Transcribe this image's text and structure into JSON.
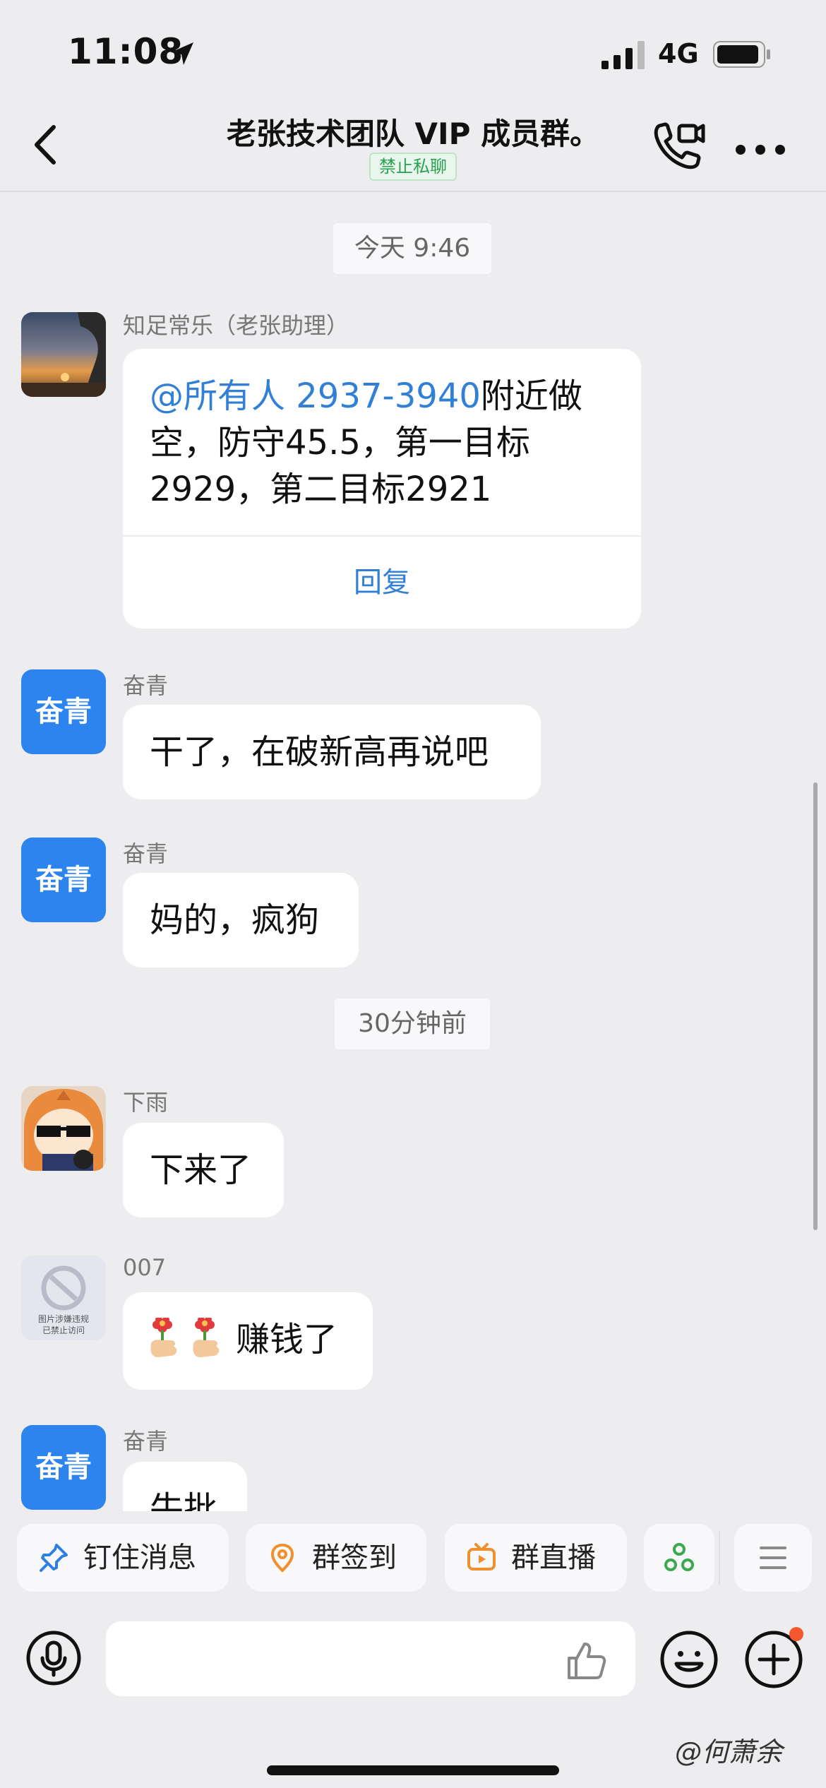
{
  "status_bar": {
    "time": "11:08",
    "network": "4G"
  },
  "header": {
    "title": "老张技术团队 VIP 成员群。",
    "badge": "禁止私聊"
  },
  "timestamps": [
    "今天 9:46",
    "30分钟前"
  ],
  "messages": [
    {
      "sender": "知足常乐（老张助理）",
      "mention": "@所有人 ",
      "text_line1_rest": "2937-3940附近做",
      "text_line1": "2937-3940",
      "text_line2": "空，防守45.5，第一目标",
      "text_line3": "2929，第二目标2921",
      "reply_label": "回复",
      "avatar": "sunset-photo"
    },
    {
      "sender": "奋青",
      "avatar_text": "奋青",
      "text": "干了，在破新高再说吧"
    },
    {
      "sender": "奋青",
      "avatar_text": "奋青",
      "text": "妈的，疯狗"
    },
    {
      "sender": "下雨",
      "avatar": "anime-sunglasses",
      "text": "下来了"
    },
    {
      "sender": "007",
      "avatar_blocked_line1": "图片涉嫌违规",
      "avatar_blocked_line2": "已禁止访问",
      "text": "赚钱了",
      "emoji": "flower-thumb-emoji"
    },
    {
      "sender": "奋青",
      "avatar_text": "奋青",
      "text": "牛批"
    }
  ],
  "quick_actions": [
    {
      "label": "钉住消息",
      "icon": "pin-icon"
    },
    {
      "label": "群签到",
      "icon": "location-icon"
    },
    {
      "label": "群直播",
      "icon": "tv-icon"
    },
    {
      "label": "",
      "icon": "apps-icon"
    },
    {
      "label": "",
      "icon": "menu-icon"
    }
  ],
  "watermark": "@何萧余",
  "colors": {
    "background": "#ededf0",
    "bubble": "#ffffff",
    "mention": "#3280d6",
    "avatar_blue": "#2d84ee",
    "badge_green": "#2aa152",
    "reply": "#3280d6",
    "notification_dot": "#f2582e"
  }
}
